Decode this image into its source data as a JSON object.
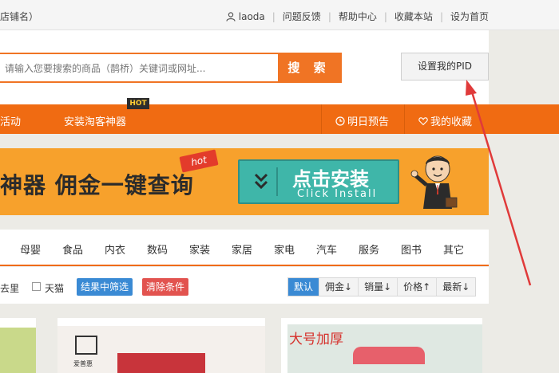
{
  "topbar": {
    "left_text": "店铺名）",
    "username": "laoda",
    "links": [
      "问题反馈",
      "帮助中心",
      "收藏本站",
      "设为首页"
    ]
  },
  "header": {
    "search_placeholder": "请输入您要搜索的商品（鹊桥）关键词或网址...",
    "search_button": "搜 索",
    "pid_button": "设置我的PID"
  },
  "nav": {
    "items": [
      "活动",
      "安装淘客神器"
    ],
    "hot_badge": "HOT",
    "right_items": [
      "明日预告",
      "我的收藏"
    ]
  },
  "banner": {
    "slogan": "神器  佣金一键查询",
    "hot_tag": "hot",
    "install_title": "点击安装",
    "install_subtitle": "Click Install"
  },
  "categories": [
    "母婴",
    "食品",
    "内衣",
    "数码",
    "家装",
    "家居",
    "家电",
    "汽车",
    "服务",
    "图书",
    "其它"
  ],
  "filters": {
    "text_left": "去里",
    "tmall_label": "天猫",
    "filter_in_results": "结果中筛选",
    "clear_conditions": "清除条件",
    "sort_options": [
      "默认",
      "佣金↓",
      "销量↓",
      "价格↑",
      "最新↓"
    ]
  },
  "products": {
    "p2_logo": "爱普惠",
    "p3_text": "大号加厚"
  },
  "colors": {
    "accent": "#f06b12",
    "search_orange": "#f07424",
    "install_teal": "#3fb6a9",
    "filter_blue": "#3a8ad4",
    "clear_red": "#e2534f",
    "annotation_red": "#e03a3a"
  }
}
